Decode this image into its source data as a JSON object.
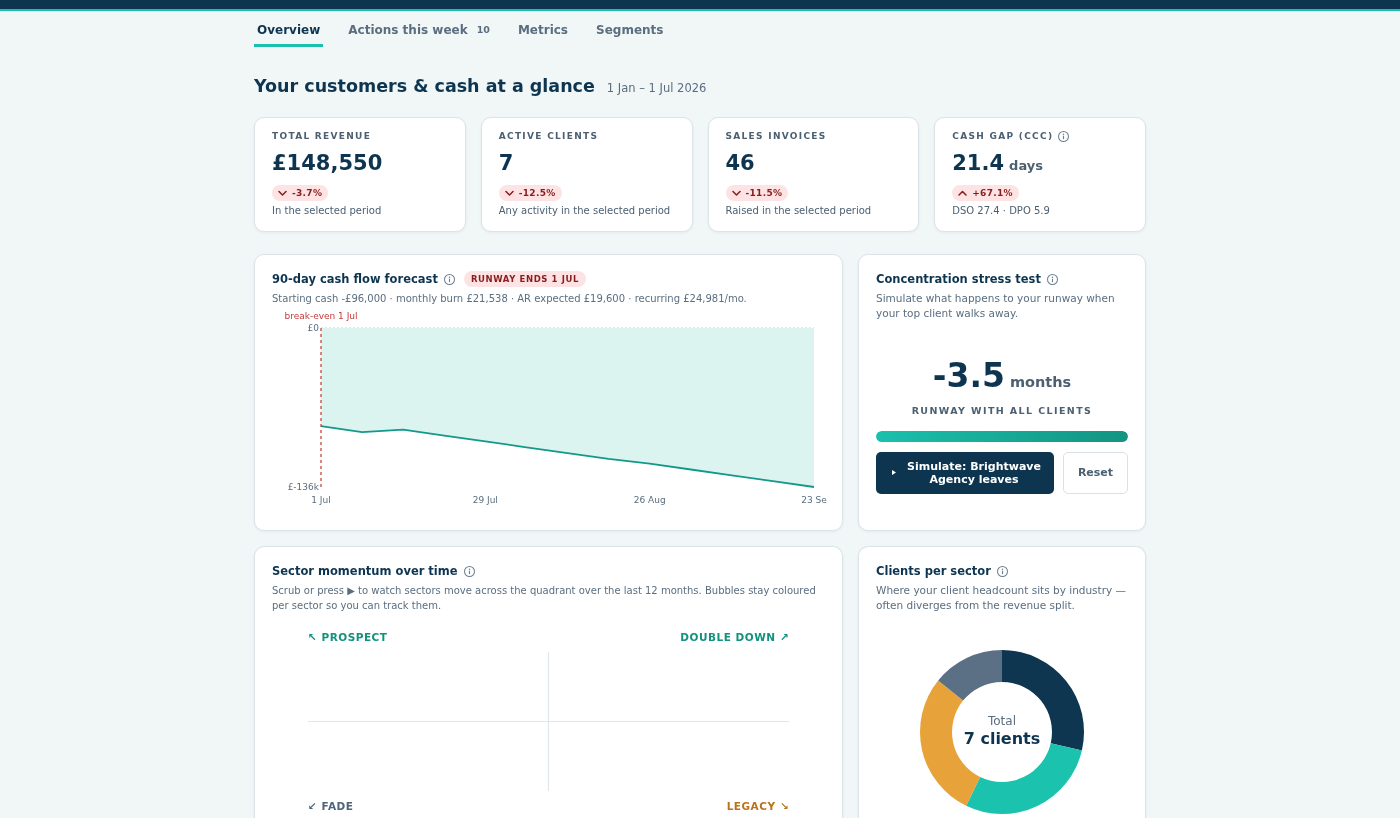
{
  "tabs": [
    {
      "label": "Overview",
      "selected": true
    },
    {
      "label": "Actions this week",
      "count": "10",
      "selected": false
    },
    {
      "label": "Metrics",
      "selected": false
    },
    {
      "label": "Segments",
      "selected": false
    }
  ],
  "header": {
    "title": "Your customers & cash at a glance",
    "date_range": "1 Jan – 1 Jul 2026"
  },
  "kpis": [
    {
      "label": "TOTAL REVENUE",
      "info": false,
      "value": "£148,550",
      "change": "-3.7%",
      "increase": false,
      "note": "In the selected period"
    },
    {
      "label": "ACTIVE CLIENTS",
      "info": false,
      "value": "7",
      "change": "-12.5%",
      "increase": false,
      "note": "Any activity in the selected period"
    },
    {
      "label": "SALES INVOICES",
      "info": false,
      "value": "46",
      "change": "-11.5%",
      "increase": false,
      "note": "Raised in the selected period"
    },
    {
      "label": "CASH GAP (CCC)",
      "info": true,
      "value": "21.4",
      "unit": "days",
      "change": "+67.1%",
      "increase": true,
      "note": "DSO 27.4 · DPO 5.9"
    }
  ],
  "cash_flow": {
    "title": "90-day cash flow forecast",
    "info": true,
    "badge": "RUNWAY ENDS 1 JUL",
    "summary": "Starting cash -£96,000 · monthly burn £21,538 · AR expected £19,600 · recurring £24,981/mo.",
    "chart_data": {
      "type": "area",
      "categories": [
        "1 Jul",
        null,
        null,
        null,
        "29 Jul",
        null,
        null,
        null,
        "26 Aug",
        null,
        null,
        null,
        "23 Se"
      ],
      "series": [
        {
          "color": "#13998a",
          "values": [
            -84,
            -89,
            -87,
            -92,
            -97,
            -102,
            -107,
            -112,
            -116,
            -121,
            -126,
            -131,
            -136
          ]
        }
      ],
      "ylim": [
        -136,
        0
      ],
      "yticks": [
        {
          "value": 0,
          "label": "£0"
        },
        {
          "value": -136,
          "label": "£-136k"
        }
      ],
      "annotations": [
        "break-even 1 Jul"
      ]
    }
  },
  "stress_test": {
    "title": "Concentration stress test",
    "info": true,
    "description": "Simulate what happens to your runway when your top client walks away.",
    "value": "-3.5",
    "unit": "months",
    "caption": "RUNWAY WITH ALL CLIENTS",
    "level": 1,
    "buttons": [
      {
        "label": "Simulate: Brightwave Agency leaves",
        "kind": "primary"
      },
      {
        "label": "Reset",
        "kind": "secondary"
      }
    ]
  },
  "sector_momentum": {
    "title": "Sector momentum over time",
    "info": true,
    "description": "Scrub or press ▶ to watch sectors move across the quadrant over the last 12 months. Bubbles stay coloured per sector so you can track them.",
    "quadrant_labels": [
      {
        "label": "↖ PROSPECT",
        "color": "#12917f"
      },
      {
        "label": "DOUBLE DOWN ↗",
        "color": "#12917f"
      },
      {
        "label": "↙ FADE",
        "color": "#4f6478"
      },
      {
        "label": "LEGACY ↘",
        "color": "#b8731c"
      }
    ]
  },
  "clients_per_sector": {
    "title": "Clients per sector",
    "info": true,
    "description": "Where your client headcount sits by industry — often diverges from the revenue split.",
    "center_label": "Total",
    "center_value": "7 clients",
    "chart_data": {
      "type": "donut",
      "values": [
        28.6,
        28.6,
        28.6,
        14.2
      ],
      "colors": [
        "#0e3650",
        "#1bc2ae",
        "#e8a23a",
        "#5b7084"
      ]
    }
  }
}
